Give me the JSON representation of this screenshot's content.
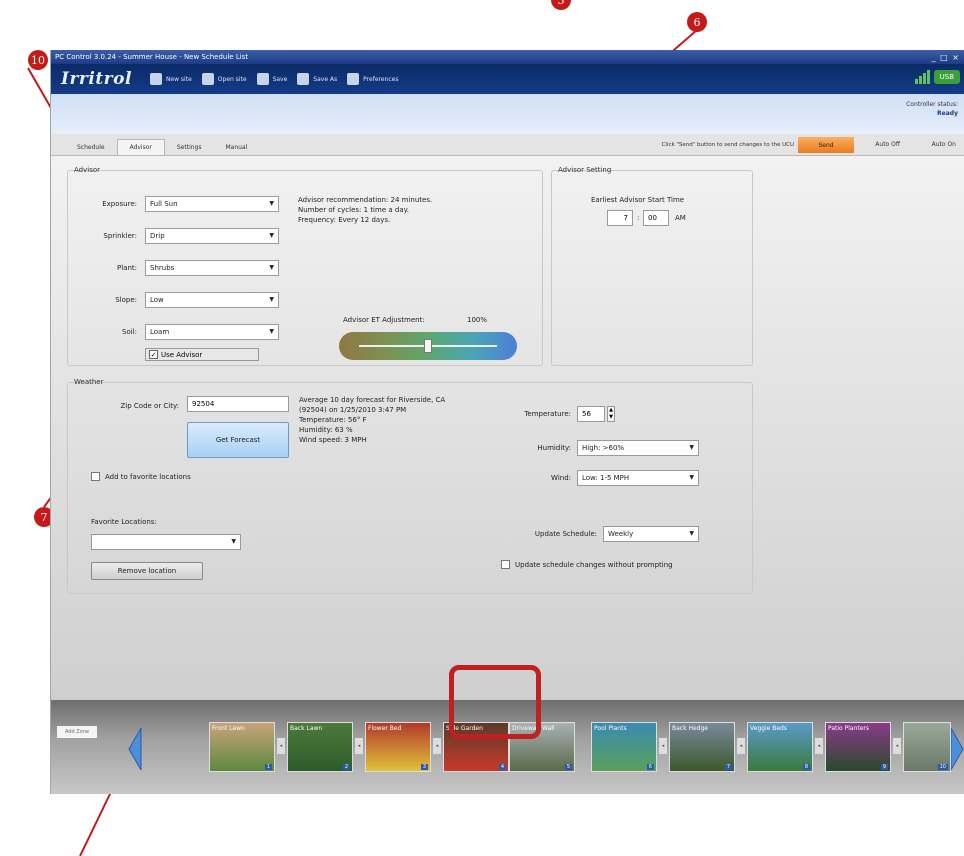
{
  "callouts": {
    "c10": "10",
    "c6": "6",
    "c7": "7",
    "c5": "5"
  },
  "window": {
    "title": "PC Control 3.0.24 - Summer House - New Schedule List",
    "controls": "_ □ ×"
  },
  "toolbar": {
    "logo": "Irritrol",
    "items": [
      {
        "label": "New site"
      },
      {
        "label": "Open site"
      },
      {
        "label": "Save"
      },
      {
        "label": "Save As"
      },
      {
        "label": "Preferences"
      }
    ],
    "usb": "USB"
  },
  "controller": {
    "label": "Controller status:",
    "value": "Ready"
  },
  "tabs": [
    "Schedule",
    "Advisor",
    "Settings",
    "Manual"
  ],
  "send_hint": "Click \"Send\" button to send changes to the UCU",
  "send": "Send",
  "auto_off": "Auto Off",
  "auto_on": "Auto On",
  "advisor": {
    "title": "Advisor",
    "exposure_label": "Exposure:",
    "exposure": "Full Sun",
    "sprinkler_label": "Sprinkler:",
    "sprinkler": "Drip",
    "plant_label": "Plant:",
    "plant": "Shrubs",
    "slope_label": "Slope:",
    "slope": "Low",
    "soil_label": "Soil:",
    "soil": "Loam",
    "use_advisor": "Use Advisor",
    "recommendation": "Advisor recommendation: 24 minutes.",
    "cycles": "Number of cycles: 1 time a day.",
    "frequency": "Frequency:  Every 12 days.",
    "et_label": "Advisor ET Adjustment:",
    "et_value": "100%",
    "et_level": 0.5
  },
  "advisor_setting": {
    "title": "Advisor Setting",
    "start_label": "Earliest Advisor Start Time",
    "hour": "7",
    "colon": ":",
    "minute": "00",
    "ampm": "AM"
  },
  "weather": {
    "title": "Weather",
    "zip_label": "Zip Code or City:",
    "zip": "92504",
    "forecast_button": "Get Forecast",
    "forecast_line1": "Average 10 day forecast for Riverside, CA",
    "forecast_line2": "(92504) on 1/25/2010 3:47 PM",
    "forecast_line3": "Temperature: 56° F",
    "forecast_line4": "Humidity: 63 %",
    "forecast_line5": "Wind speed: 3 MPH",
    "add_favorite": "Add to favorite locations",
    "favorites_label": "Favorite Locations:",
    "favorites_value": "",
    "remove_button": "Remove location",
    "temperature_label": "Temperature:",
    "temperature": "56",
    "humidity_label": "Humidity:",
    "humidity": "High: >60%",
    "wind_label": "Wind:",
    "wind": "Low: 1-5 MPH",
    "update_label": "Update Schedule:",
    "update": "Weekly",
    "update_silently": "Update schedule changes without prompting"
  },
  "strip": {
    "add_zone": "Add Zone",
    "thumbs": [
      {
        "caption": "Front Lawn",
        "num": "1"
      },
      {
        "caption": "Back Lawn",
        "num": "2"
      },
      {
        "caption": "Flower Bed",
        "num": "3"
      },
      {
        "caption": "Side Garden",
        "num": "4"
      },
      {
        "caption": "Driveway Wall",
        "num": "5"
      },
      {
        "caption": "Pool Plants",
        "num": "6"
      },
      {
        "caption": "Back Hedge",
        "num": "7"
      },
      {
        "caption": "Veggie Beds",
        "num": "8"
      },
      {
        "caption": "Patio Planters",
        "num": "9"
      },
      {
        "caption": "",
        "num": "10"
      }
    ]
  },
  "colors": {
    "accent": "#c41a1a",
    "toolbar": "#0b2a66",
    "send": "#ec7b1f"
  }
}
